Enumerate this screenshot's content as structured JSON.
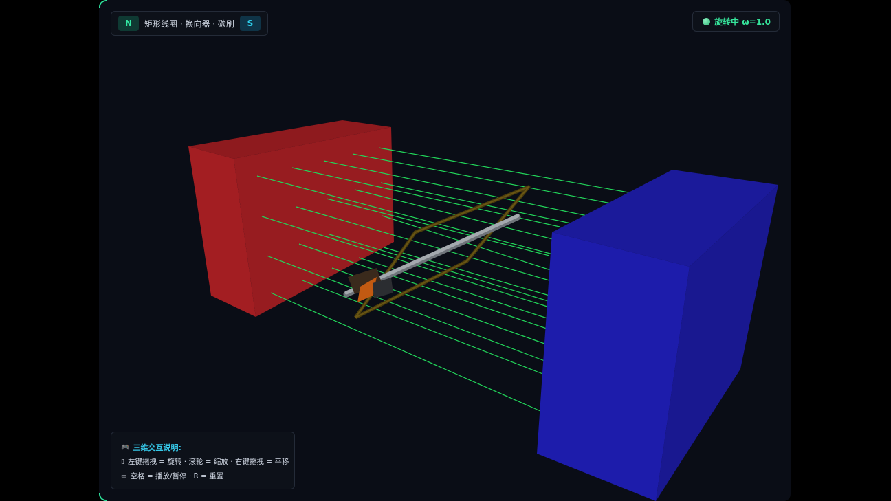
{
  "legend": {
    "north_label": "N",
    "components": "矩形线圈 · 换向器 · 碳刷",
    "south_label": "S"
  },
  "status": {
    "text": "旋转中 ω=1.0",
    "color": "#36e49b"
  },
  "help": {
    "title": "三维交互说明:",
    "mouse_line": "左键拖拽 = 旋转 · 滚轮 = 缩放 · 右键拖拽 = 平移",
    "keyboard_line": "空格 = 播放/暂停 · R = 重置",
    "icons": [
      "gamepad-icon",
      "mouse-icon",
      "keyboard-icon"
    ]
  },
  "scene": {
    "north_pole_color": "#9a1b1f",
    "south_pole_color": "#1c1a9e",
    "field_line_color": "#22d65a",
    "coil_color": "#5a4a12",
    "axle_color": "#9aa0a6",
    "commutator_color": "#c25a12"
  }
}
